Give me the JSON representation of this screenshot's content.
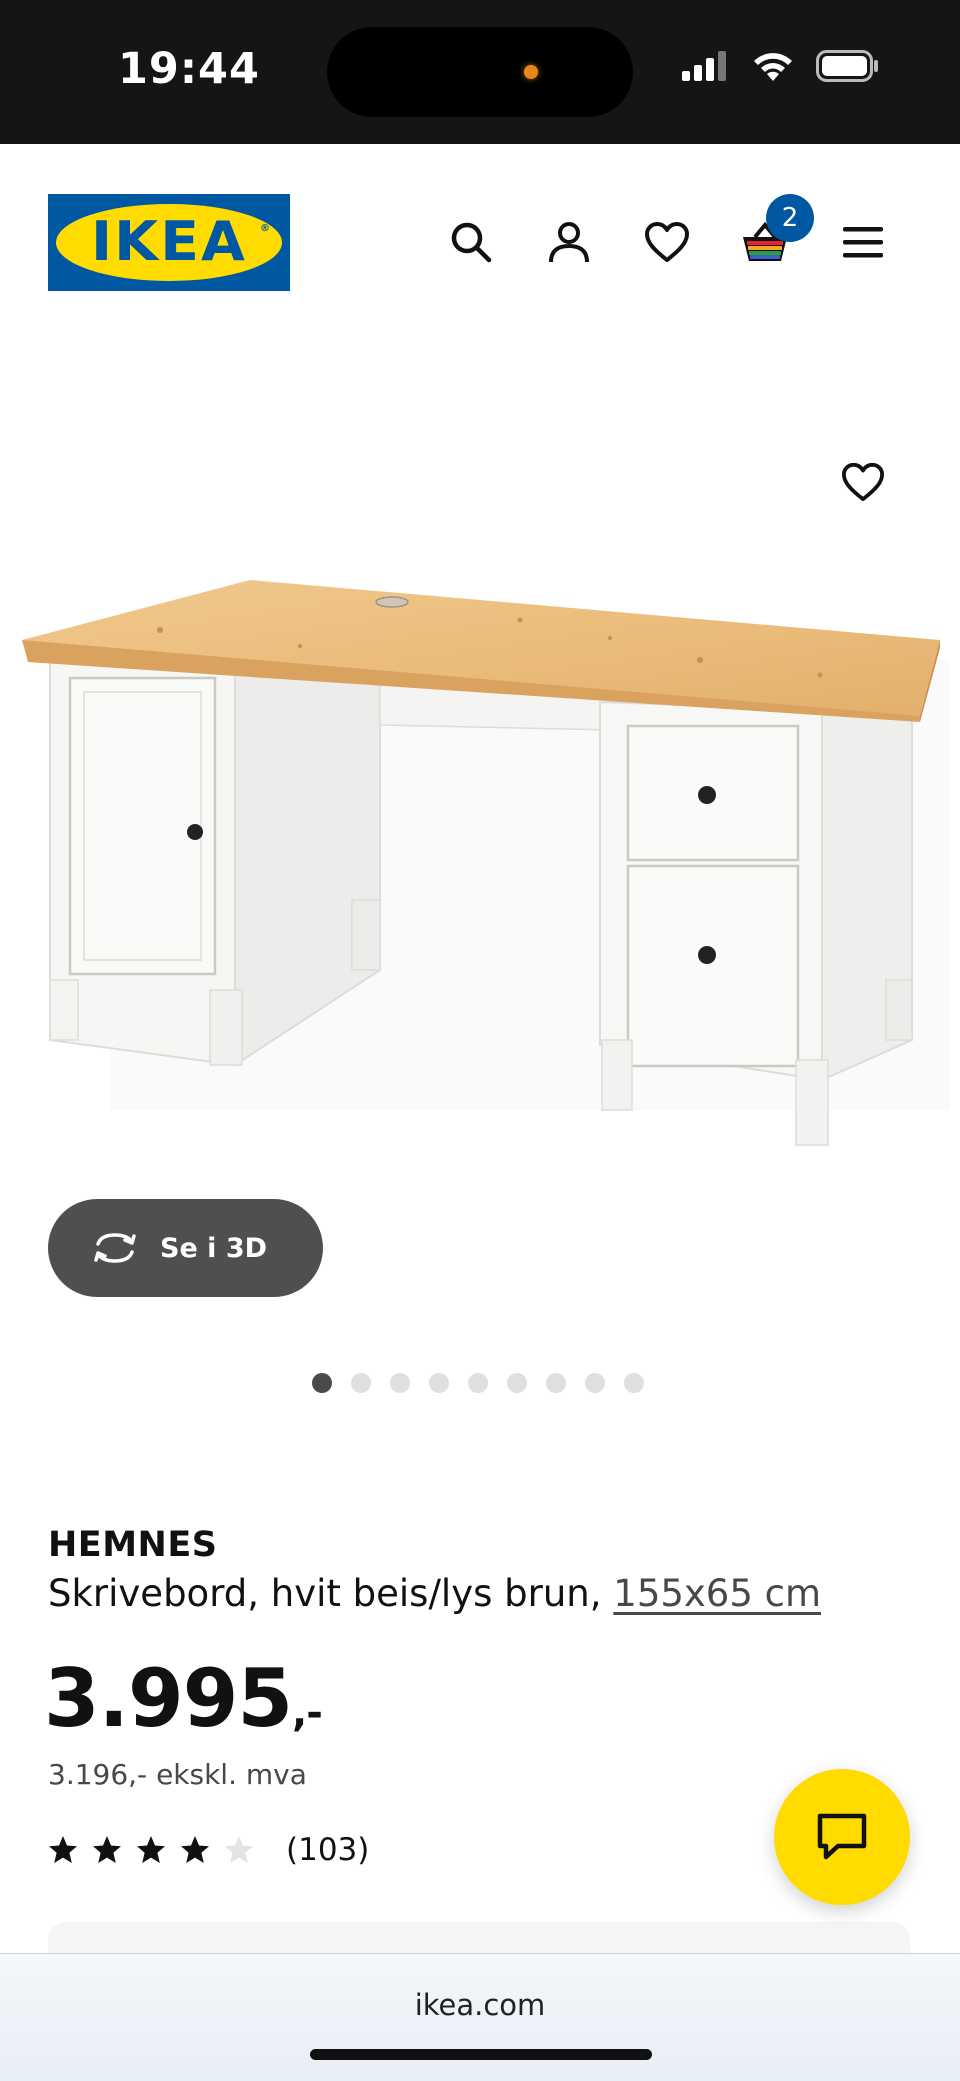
{
  "status_bar": {
    "time": "19:44"
  },
  "header": {
    "logo_text": "IKEA",
    "cart_count": "2"
  },
  "product": {
    "three_d_label": "Se i 3D",
    "carousel_dots": 9,
    "carousel_active_index": 0,
    "name": "HEMNES",
    "description": "Skrivebord, hvit beis/lys brun,",
    "size": "155x65 cm",
    "price": "3.995",
    "price_suffix": ",-",
    "price_ex_vat": "3.196,- ekskl. mva",
    "rating_stars": 4,
    "rating_max": 5,
    "review_count": "(103)"
  },
  "browser": {
    "url": "ikea.com"
  },
  "colors": {
    "ikea_blue": "#0058a3",
    "ikea_yellow": "#ffdb00",
    "status_bar": "#151515",
    "button_dark": "#4f4f4f"
  },
  "icons": [
    "search-icon",
    "profile-icon",
    "heart-icon",
    "shopping-bag-icon",
    "menu-icon",
    "rotate-3d-icon",
    "chat-icon",
    "star-icon"
  ]
}
